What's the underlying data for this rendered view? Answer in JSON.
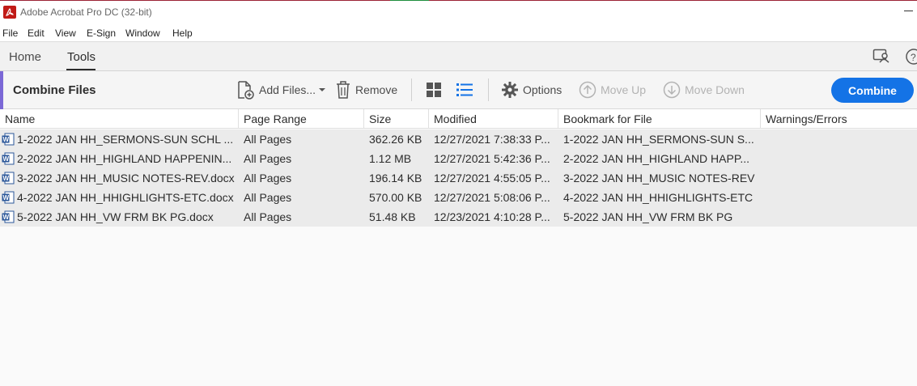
{
  "window": {
    "title": "Adobe Acrobat Pro DC (32-bit)"
  },
  "menu": {
    "items": [
      "File",
      "Edit",
      "View",
      "E-Sign",
      "Window",
      "Help"
    ]
  },
  "nav": {
    "home": "Home",
    "tools": "Tools",
    "active": "Tools"
  },
  "toolbar": {
    "title": "Combine Files",
    "add_files": "Add Files...",
    "remove": "Remove",
    "options": "Options",
    "move_up": "Move Up",
    "move_down": "Move Down",
    "combine": "Combine",
    "accent_color": "#7b68d6",
    "combine_color": "#1473e6",
    "active_view": "list"
  },
  "table": {
    "columns": [
      "Name",
      "Page Range",
      "Size",
      "Modified",
      "Bookmark for File",
      "Warnings/Errors"
    ],
    "rows": [
      {
        "name": "1-2022 JAN HH_SERMONS-SUN SCHL ...",
        "page_range": "All Pages",
        "size": "362.26 KB",
        "modified": "12/27/2021 7:38:33 P...",
        "bookmark": "1-2022 JAN HH_SERMONS-SUN S...",
        "warnings": ""
      },
      {
        "name": "2-2022 JAN HH_HIGHLAND HAPPENIN...",
        "page_range": "All Pages",
        "size": "1.12 MB",
        "modified": "12/27/2021 5:42:36 P...",
        "bookmark": "2-2022 JAN HH_HIGHLAND HAPP...",
        "warnings": ""
      },
      {
        "name": "3-2022 JAN HH_MUSIC NOTES-REV.docx",
        "page_range": "All Pages",
        "size": "196.14 KB",
        "modified": "12/27/2021 4:55:05 P...",
        "bookmark": "3-2022 JAN HH_MUSIC NOTES-REV",
        "warnings": ""
      },
      {
        "name": "4-2022 JAN HH_HHIGHLIGHTS-ETC.docx",
        "page_range": "All Pages",
        "size": "570.00 KB",
        "modified": "12/27/2021 5:08:06 P...",
        "bookmark": "4-2022 JAN HH_HHIGHLIGHTS-ETC",
        "warnings": ""
      },
      {
        "name": "5-2022 JAN HH_VW FRM BK PG.docx",
        "page_range": "All Pages",
        "size": "51.48 KB",
        "modified": "12/23/2021 4:10:28 P...",
        "bookmark": "5-2022 JAN HH_VW FRM BK PG",
        "warnings": ""
      }
    ]
  }
}
